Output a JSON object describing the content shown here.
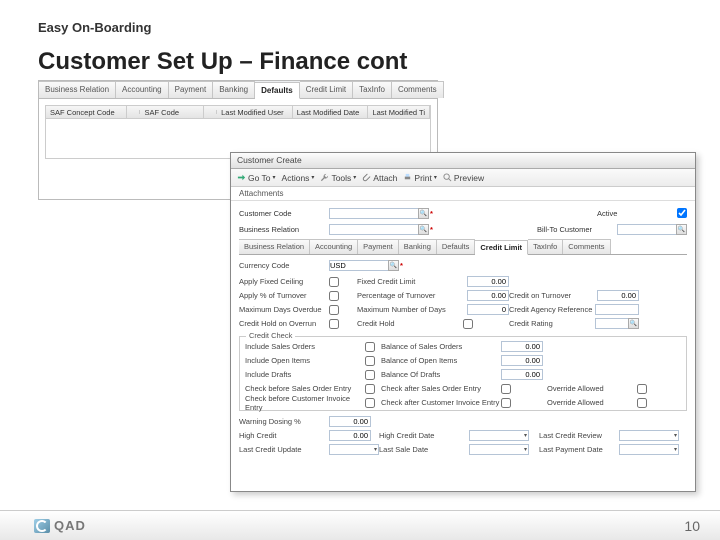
{
  "slide": {
    "small_title": "Easy On-Boarding",
    "title": "Customer Set Up – Finance cont"
  },
  "back_window": {
    "tabs": [
      "Business Relation",
      "Accounting",
      "Payment",
      "Banking",
      "Defaults",
      "Credit Limit",
      "TaxInfo",
      "Comments"
    ],
    "active_tab_index": 4,
    "columns": [
      "SAF Concept Code",
      "",
      "SAF Code",
      "",
      "Last Modified User",
      "Last Modified Date",
      "Last Modified Ti"
    ]
  },
  "front_window": {
    "title": "Customer Create",
    "toolbar": {
      "goto": "Go To",
      "actions": "Actions",
      "tools": "Tools",
      "attach": "Attach",
      "print": "Print",
      "preview": "Preview"
    },
    "attachments_label": "Attachments",
    "top": {
      "customer_code_label": "Customer Code",
      "active_label": "Active",
      "active_checked": true,
      "business_relation_label": "Business Relation",
      "bill_to_label": "Bill-To Customer"
    },
    "inner_tabs": [
      "Business Relation",
      "Accounting",
      "Payment",
      "Banking",
      "Defaults",
      "Credit Limit",
      "TaxInfo",
      "Comments"
    ],
    "inner_active_index": 5,
    "credit": {
      "currency_label": "Currency Code",
      "currency_value": "USD",
      "rows": {
        "apply_fixed_ceiling": "Apply Fixed Ceiling",
        "fixed_credit_limit": "Fixed Credit Limit",
        "fixed_credit_limit_val": "0.00",
        "apply_pct_turnover": "Apply % of Turnover",
        "pct_turnover": "Percentage of Turnover",
        "pct_turnover_val": "0.00",
        "credit_on_turnover": "Credit on Turnover",
        "credit_on_turnover_val": "0.00",
        "max_days_overdue": "Maximum Days Overdue",
        "max_num_days": "Maximum Number of Days",
        "max_num_days_val": "0",
        "credit_agency_ref": "Credit Agency Reference",
        "credit_hold_overrun": "Credit Hold on Overrun",
        "credit_hold": "Credit Hold",
        "credit_rating": "Credit Rating"
      },
      "credit_check_title": "Credit Check",
      "credit_check": {
        "include_sales_orders": "Include Sales Orders",
        "balance_sales_orders": "Balance of Sales Orders",
        "balance_sales_orders_val": "0.00",
        "include_open_items": "Include Open Items",
        "balance_open_items": "Balance of Open Items",
        "balance_open_items_val": "0.00",
        "include_drafts": "Include Drafts",
        "balance_drafts": "Balance Of Drafts",
        "balance_drafts_val": "0.00",
        "check_before_so_entry": "Check before Sales Order Entry",
        "check_after_so_entry": "Check after Sales Order Entry",
        "override_allowed_1": "Override Allowed",
        "check_before_inv_entry": "Check before Customer Invoice Entry",
        "check_after_inv_entry": "Check after Customer Invoice Entry",
        "override_allowed_2": "Override Allowed"
      },
      "bottom": {
        "warning_dosing": "Warning Dosing %",
        "warning_dosing_val": "0.00",
        "high_credit": "High Credit",
        "high_credit_val": "0.00",
        "high_credit_date": "High Credit Date",
        "last_credit_review": "Last Credit Review",
        "last_credit_update": "Last Credit Update",
        "last_sale_date": "Last Sale Date",
        "last_payment_date": "Last Payment Date"
      }
    }
  },
  "footer": {
    "brand": "QAD",
    "page": "10"
  }
}
